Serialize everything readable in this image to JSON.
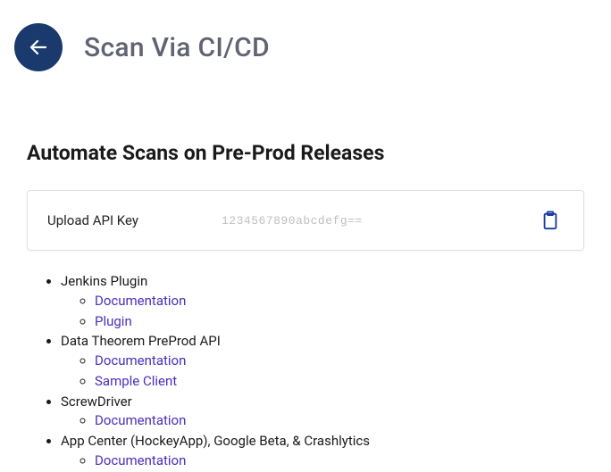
{
  "header": {
    "title": "Scan Via CI/CD"
  },
  "section": {
    "heading": "Automate Scans on Pre-Prod Releases"
  },
  "apiCard": {
    "label": "Upload API Key",
    "keyValue": "1234567890abcdefg=="
  },
  "integrations": [
    {
      "title": "Jenkins Plugin",
      "links": [
        {
          "label": "Documentation"
        },
        {
          "label": "Plugin"
        }
      ]
    },
    {
      "title": "Data Theorem PreProd API",
      "links": [
        {
          "label": "Documentation"
        },
        {
          "label": "Sample Client"
        }
      ]
    },
    {
      "title": "ScrewDriver",
      "links": [
        {
          "label": "Documentation"
        }
      ]
    },
    {
      "title": "App Center (HockeyApp), Google Beta, & Crashlytics",
      "links": [
        {
          "label": "Documentation"
        }
      ]
    }
  ]
}
